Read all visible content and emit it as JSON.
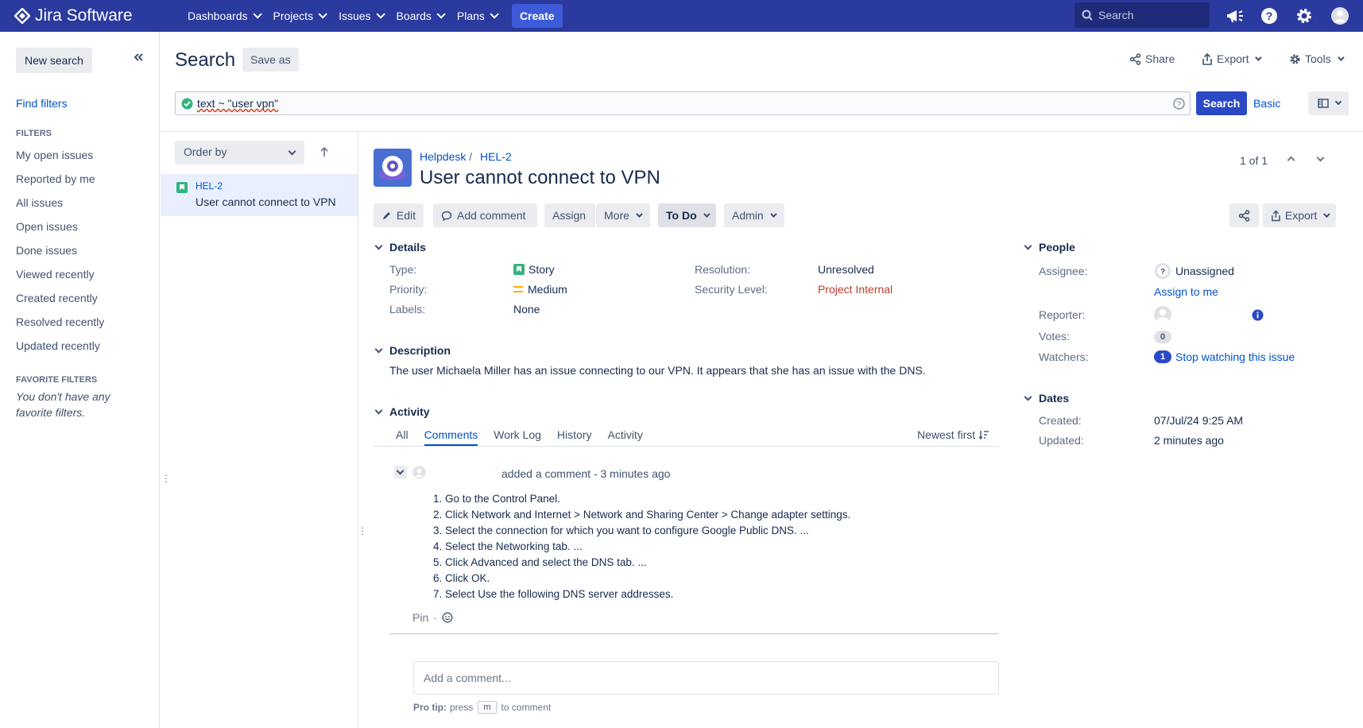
{
  "topnav": {
    "app_name": "Jira Software",
    "items": [
      {
        "label": "Dashboards"
      },
      {
        "label": "Projects"
      },
      {
        "label": "Issues"
      },
      {
        "label": "Boards"
      },
      {
        "label": "Plans"
      }
    ],
    "create_label": "Create",
    "search_placeholder": "Search",
    "brand_color": "#2b3a9e"
  },
  "sidebar": {
    "new_search": "New search",
    "find_filters": "Find filters",
    "filters_heading": "FILTERS",
    "filters": [
      "My open issues",
      "Reported by me",
      "All issues",
      "Open issues",
      "Done issues",
      "Viewed recently",
      "Created recently",
      "Resolved recently",
      "Updated recently"
    ],
    "favorite_heading": "FAVORITE FILTERS",
    "favorite_note": "You don't have any favorite filters."
  },
  "search": {
    "title": "Search",
    "save_as": "Save as",
    "share": "Share",
    "export": "Export",
    "tools": "Tools",
    "jql": "text ~ \"user vpn\"",
    "search_button": "Search",
    "basic_link": "Basic"
  },
  "results": {
    "order_by": "Order by",
    "items": [
      {
        "key": "HEL-2",
        "summary": "User cannot connect to VPN"
      }
    ]
  },
  "issue": {
    "project": "Helpdesk",
    "key": "HEL-2",
    "title": "User cannot connect to VPN",
    "pager": "1 of 1",
    "ops": {
      "edit": "Edit",
      "add_comment": "Add comment",
      "assign": "Assign",
      "more": "More",
      "status": "To Do",
      "admin": "Admin",
      "export": "Export"
    },
    "details": {
      "heading": "Details",
      "type_label": "Type:",
      "type_value": "Story",
      "priority_label": "Priority:",
      "priority_value": "Medium",
      "labels_label": "Labels:",
      "labels_value": "None",
      "resolution_label": "Resolution:",
      "resolution_value": "Unresolved",
      "security_label": "Security Level:",
      "security_value": "Project Internal"
    },
    "people": {
      "heading": "People",
      "assignee_label": "Assignee:",
      "assignee_value": "Unassigned",
      "assign_to_me": "Assign to me",
      "reporter_label": "Reporter:",
      "votes_label": "Votes:",
      "votes_value": "0",
      "watchers_label": "Watchers:",
      "watchers_count": "1",
      "watchers_action": "Stop watching this issue"
    },
    "dates": {
      "heading": "Dates",
      "created_label": "Created:",
      "created_value": "07/Jul/24 9:25 AM",
      "updated_label": "Updated:",
      "updated_value": "2 minutes ago"
    },
    "description": {
      "heading": "Description",
      "text": "The user Michaela Miller has an issue connecting to our VPN. It appears that she has an issue with the DNS."
    },
    "activity": {
      "heading": "Activity",
      "tabs": [
        "All",
        "Comments",
        "Work Log",
        "History",
        "Activity"
      ],
      "sort": "Newest first",
      "comment_meta": "added a comment - 3 minutes ago",
      "steps": [
        "1. Go to the Control Panel.",
        "2. Click Network and Internet > Network and Sharing Center > Change adapter settings.",
        "3. Select the connection for which you want to configure Google Public DNS. ...",
        "4. Select the Networking tab. ...",
        "5. Click Advanced and select the DNS tab. ...",
        "6. Click OK.",
        "7. Select Use the following DNS server addresses."
      ],
      "pin": "Pin",
      "add_comment_placeholder": "Add a comment...",
      "protip_prefix": "Pro tip:",
      "protip_press": "press",
      "protip_key": "m",
      "protip_suffix": "to comment"
    }
  }
}
